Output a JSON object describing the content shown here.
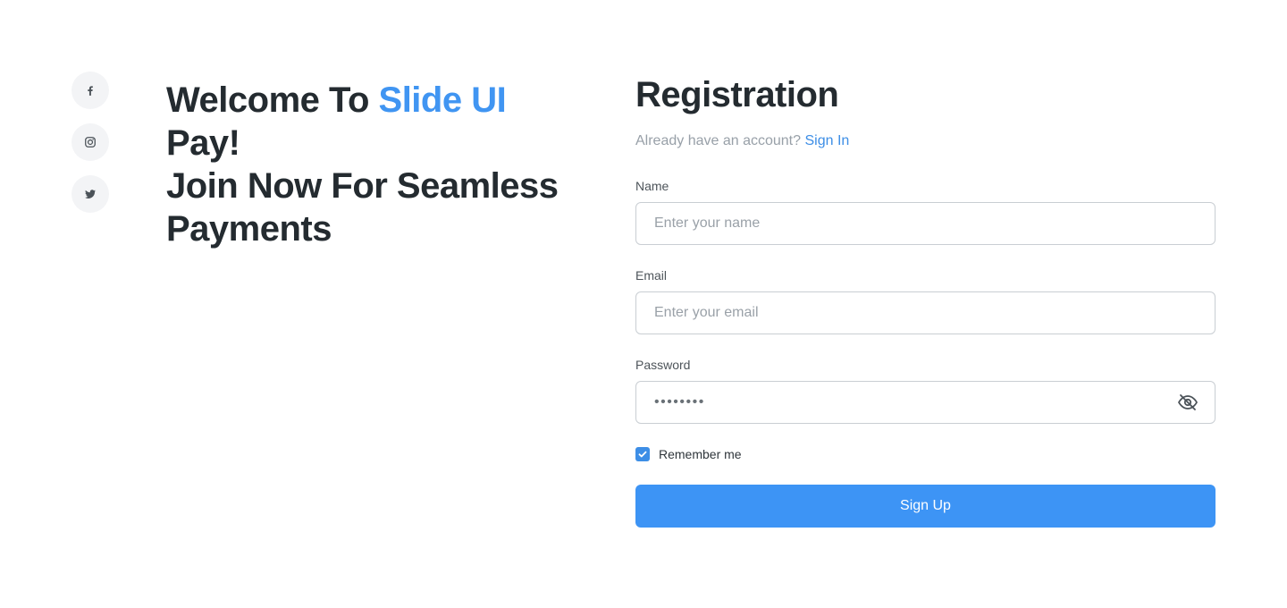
{
  "social": {
    "items": [
      {
        "icon": "facebook-icon"
      },
      {
        "icon": "instagram-icon"
      },
      {
        "icon": "twitter-icon"
      }
    ]
  },
  "hero": {
    "prefix": "Welcome To ",
    "brand": "Slide UI",
    "suffix": " Pay!",
    "line2": "Join Now For Seamless",
    "line3": "Payments"
  },
  "form": {
    "title": "Registration",
    "account_prompt": "Already have an account? ",
    "signin_link": "Sign In",
    "name": {
      "label": "Name",
      "placeholder": "Enter your name",
      "value": ""
    },
    "email": {
      "label": "Email",
      "placeholder": "Enter your email",
      "value": ""
    },
    "password": {
      "label": "Password",
      "masked_value": "••••••••",
      "visibility_icon": "eye-off-icon"
    },
    "remember": {
      "label": "Remember me",
      "checked": true
    },
    "submit_label": "Sign Up"
  },
  "colors": {
    "accent": "#4095f2",
    "button": "#3d94f5",
    "heading": "#242b30",
    "muted": "#98a0a8"
  }
}
